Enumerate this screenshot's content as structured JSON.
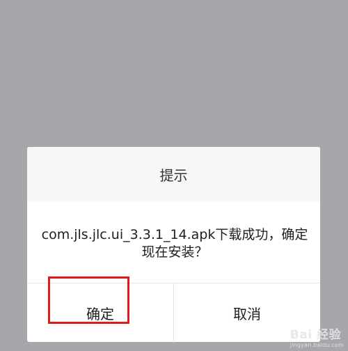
{
  "dialog": {
    "title": "提示",
    "message_line1": "com.jls.jlc.ui_3.3.1_14.apk下载成功，确定",
    "message_line2": "现在安装？",
    "confirm_label": "确定",
    "cancel_label": "取消"
  },
  "watermark": {
    "brand": "Bai  经验",
    "url": "jingyan.baidu.com"
  },
  "colors": {
    "overlay": "#a8a6aa",
    "highlight": "#dd1b1b"
  }
}
